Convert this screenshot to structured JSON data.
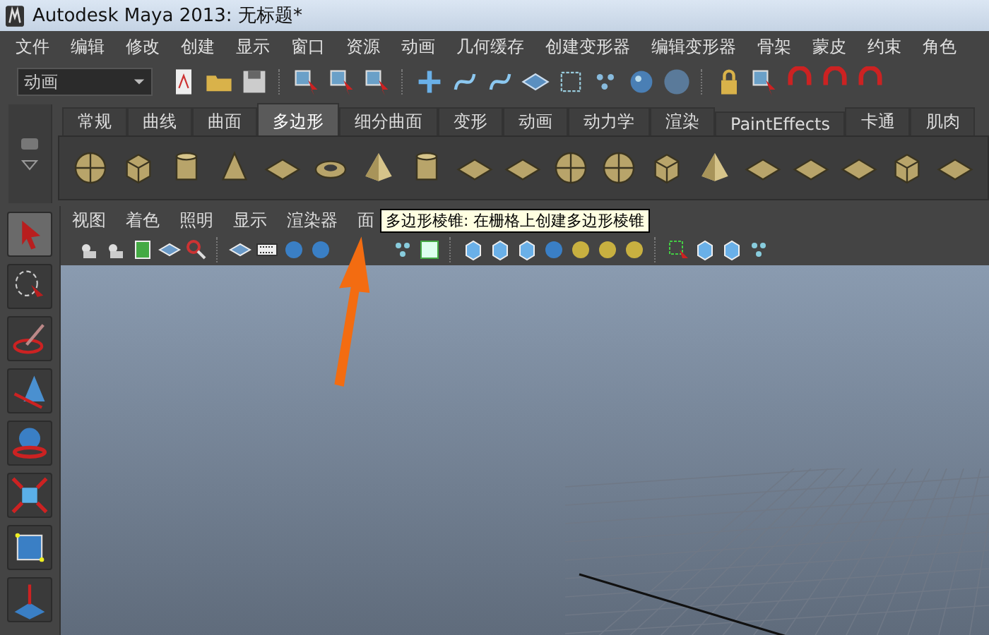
{
  "window": {
    "title": "Autodesk Maya 2013: 无标题*"
  },
  "menu_bar": [
    "文件",
    "编辑",
    "修改",
    "创建",
    "显示",
    "窗口",
    "资源",
    "动画",
    "几何缓存",
    "创建变形器",
    "编辑变形器",
    "骨架",
    "蒙皮",
    "约束",
    "角色"
  ],
  "status_line": {
    "mode_dropdown": "动画"
  },
  "shelf_tabs": [
    {
      "label": "常规",
      "selected": false
    },
    {
      "label": "曲线",
      "selected": false
    },
    {
      "label": "曲面",
      "selected": false
    },
    {
      "label": "多边形",
      "selected": true
    },
    {
      "label": "细分曲面",
      "selected": false
    },
    {
      "label": "变形",
      "selected": false
    },
    {
      "label": "动画",
      "selected": false
    },
    {
      "label": "动力学",
      "selected": false
    },
    {
      "label": "渲染",
      "selected": false
    },
    {
      "label": "PaintEffects",
      "selected": false
    },
    {
      "label": "卡通",
      "selected": false
    },
    {
      "label": "肌肉",
      "selected": false
    }
  ],
  "panel_menu": [
    "视图",
    "着色",
    "照明",
    "显示",
    "渲染器",
    "面"
  ],
  "tooltip": "多边形棱锥: 在栅格上创建多边形棱锥"
}
